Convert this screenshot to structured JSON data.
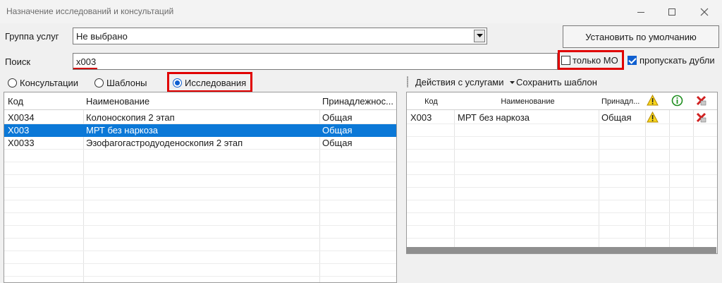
{
  "window": {
    "title": "Назначение исследований и консультаций"
  },
  "form": {
    "group_label": "Группа услуг",
    "group_value": "Не выбрано",
    "default_button": "Установить по умолчанию",
    "search_label": "Поиск",
    "search_value": "x003",
    "only_mo_label": "только МО",
    "only_mo_checked": false,
    "skip_duplicates_label": "пропускать дубли",
    "skip_duplicates_checked": true
  },
  "radio_tabs": [
    {
      "label": "Консультации",
      "selected": false
    },
    {
      "label": "Шаблоны",
      "selected": false
    },
    {
      "label": "Исследования",
      "selected": true
    }
  ],
  "left_table": {
    "columns": [
      "Код",
      "Наименование",
      "Принадлежнос..."
    ],
    "rows": [
      {
        "code": "X0034",
        "name": "Колоноскопия 2 этап",
        "owner": "Общая",
        "selected": false
      },
      {
        "code": "X003",
        "name": "МРТ без наркоза",
        "owner": "Общая",
        "selected": true
      },
      {
        "code": "X0033",
        "name": "Эзофагогастродуоденоскопия 2 этап",
        "owner": "Общая",
        "selected": false
      }
    ]
  },
  "right_toolbar": {
    "actions_label": "Действия с услугами",
    "save_template_label": "Сохранить шаблон"
  },
  "right_table": {
    "columns": [
      "Код",
      "Наименование",
      "Принадл...",
      "warning-icon",
      "info-icon",
      "delete-icon"
    ],
    "rows": [
      {
        "code": "X003",
        "name": "МРТ без наркоза",
        "owner": "Общая"
      }
    ]
  },
  "colors": {
    "selection": "#0b78d7",
    "highlight_box": "#e00000",
    "checkbox_on": "#0f5fd0"
  }
}
